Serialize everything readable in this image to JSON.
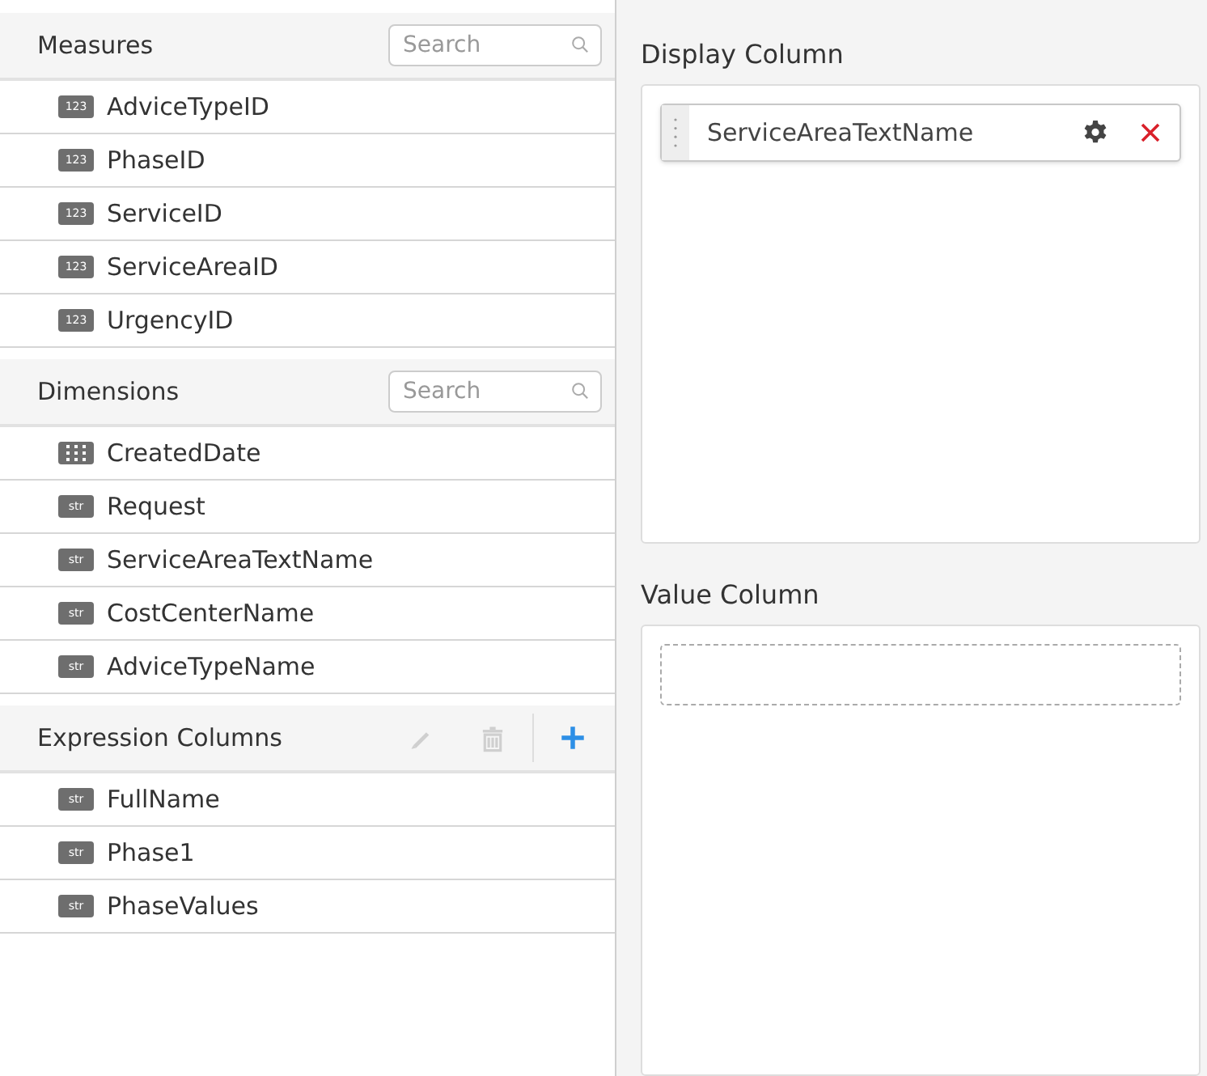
{
  "sections": [
    {
      "title": "Measures",
      "search": {
        "placeholder": "Search"
      },
      "items": [
        {
          "kind": "number",
          "badge": "123",
          "label": "AdviceTypeID"
        },
        {
          "kind": "number",
          "badge": "123",
          "label": "PhaseID"
        },
        {
          "kind": "number",
          "badge": "123",
          "label": "ServiceID"
        },
        {
          "kind": "number",
          "badge": "123",
          "label": "ServiceAreaID"
        },
        {
          "kind": "number",
          "badge": "123",
          "label": "UrgencyID"
        }
      ]
    },
    {
      "title": "Dimensions",
      "search": {
        "placeholder": "Search"
      },
      "items": [
        {
          "kind": "date",
          "label": "CreatedDate"
        },
        {
          "kind": "string",
          "badge": "str",
          "label": "Request"
        },
        {
          "kind": "string",
          "badge": "str",
          "label": "ServiceAreaTextName"
        },
        {
          "kind": "string",
          "badge": "str",
          "label": "CostCenterName"
        },
        {
          "kind": "string",
          "badge": "str",
          "label": "AdviceTypeName"
        }
      ]
    },
    {
      "title": "Expression Columns",
      "actions": [
        {
          "kind": "edit",
          "disabled": true
        },
        {
          "kind": "delete",
          "disabled": true
        },
        {
          "kind": "add",
          "disabled": false
        }
      ],
      "items": [
        {
          "kind": "string",
          "badge": "str",
          "label": "FullName"
        },
        {
          "kind": "string",
          "badge": "str",
          "label": "Phase1"
        },
        {
          "kind": "string",
          "badge": "str",
          "label": "PhaseValues"
        }
      ]
    }
  ],
  "display_column": {
    "title": "Display Column",
    "chips": [
      {
        "label": "ServiceAreaTextName"
      }
    ]
  },
  "value_column": {
    "title": "Value Column"
  }
}
